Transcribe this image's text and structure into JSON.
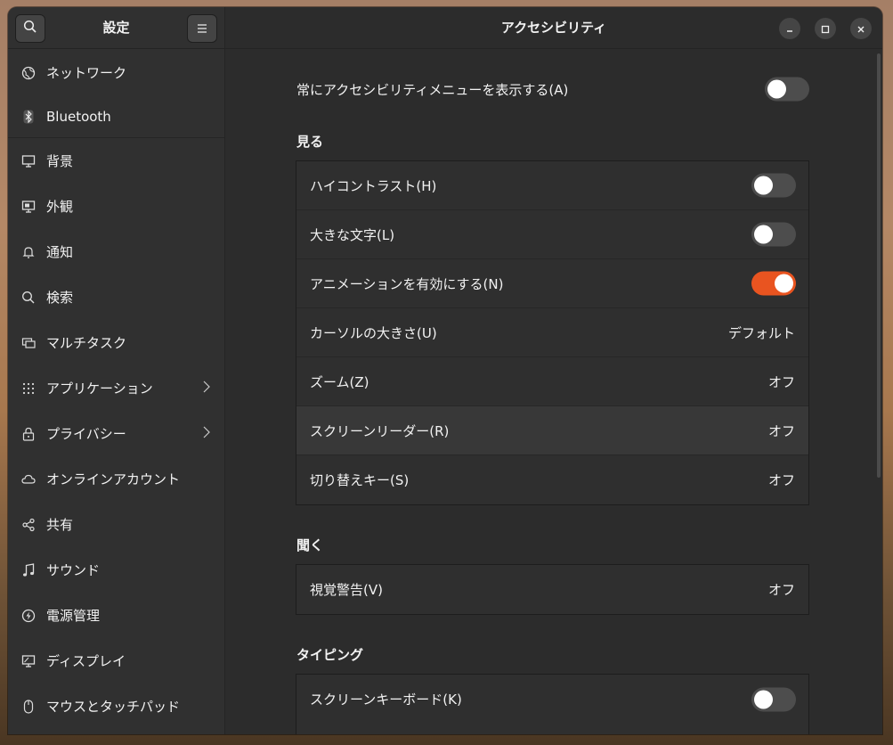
{
  "sidebar": {
    "title": "設定",
    "items": [
      {
        "label": "ネットワーク",
        "icon": "globe-icon"
      },
      {
        "label": "Bluetooth",
        "icon": "bluetooth-icon"
      },
      {
        "label": "背景",
        "icon": "monitor-icon"
      },
      {
        "label": "外観",
        "icon": "appearance-icon"
      },
      {
        "label": "通知",
        "icon": "bell-icon"
      },
      {
        "label": "検索",
        "icon": "search-icon"
      },
      {
        "label": "マルチタスク",
        "icon": "multitask-icon"
      },
      {
        "label": "アプリケーション",
        "icon": "grid-icon"
      },
      {
        "label": "プライバシー",
        "icon": "lock-icon"
      },
      {
        "label": "オンラインアカウント",
        "icon": "cloud-icon"
      },
      {
        "label": "共有",
        "icon": "share-icon"
      },
      {
        "label": "サウンド",
        "icon": "music-note-icon"
      },
      {
        "label": "電源管理",
        "icon": "power-icon"
      },
      {
        "label": "ディスプレイ",
        "icon": "display-icon"
      },
      {
        "label": "マウスとタッチパッド",
        "icon": "mouse-icon"
      }
    ]
  },
  "content": {
    "title": "アクセシビリティ",
    "always_menu": {
      "label": "常にアクセシビリティメニューを表示する(A)",
      "on": false
    },
    "seeing": {
      "title": "見る",
      "rows": [
        {
          "label": "ハイコントラスト(H)",
          "toggle": "off"
        },
        {
          "label": "大きな文字(L)",
          "toggle": "off"
        },
        {
          "label": "アニメーションを有効にする(N)",
          "toggle": "on"
        },
        {
          "label": "カーソルの大きさ(U)",
          "value": "デフォルト"
        },
        {
          "label": "ズーム(Z)",
          "value": "オフ"
        },
        {
          "label": "スクリーンリーダー(R)",
          "value": "オフ"
        },
        {
          "label": "切り替えキー(S)",
          "value": "オフ"
        }
      ]
    },
    "hearing": {
      "title": "聞く",
      "rows": [
        {
          "label": "視覚警告(V)",
          "value": "オフ"
        }
      ]
    },
    "typing": {
      "title": "タイピング",
      "rows": [
        {
          "label": "スクリーンキーボード(K)",
          "toggle": "off"
        }
      ]
    }
  },
  "colors": {
    "accent": "#e95420",
    "window_bg": "#2c2c2c",
    "sidebar_bg": "#303030"
  }
}
